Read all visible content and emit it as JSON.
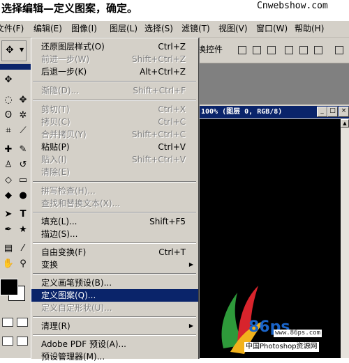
{
  "caption": "选择编辑—定义图案，确定。",
  "site": "Cnwebshow.com",
  "menubar": [
    {
      "name": "menu-file",
      "label": "文件(F)"
    },
    {
      "name": "menu-edit",
      "label": "编辑(E)"
    },
    {
      "name": "menu-image",
      "label": "图像(I)"
    },
    {
      "name": "menu-layer",
      "label": "图层(L)"
    },
    {
      "name": "menu-select",
      "label": "选择(S)"
    },
    {
      "name": "menu-filter",
      "label": "滤镜(T)"
    },
    {
      "name": "menu-view",
      "label": "视图(V)"
    },
    {
      "name": "menu-window",
      "label": "窗口(W)"
    },
    {
      "name": "menu-help",
      "label": "帮助(H)"
    }
  ],
  "optbar": {
    "label": "换控件"
  },
  "document": {
    "title": "100% (图层 0, RGB/8)"
  },
  "watermark": {
    "url": "www.86ps.com",
    "name": "中国Photoshop资源网",
    "logo": "86ps"
  },
  "edit_menu": [
    {
      "label": "还原图层样式(O)",
      "shortcut": "Ctrl+Z",
      "state": "normal"
    },
    {
      "label": "前进一步(W)",
      "shortcut": "Shift+Ctrl+Z",
      "state": "disabled"
    },
    {
      "label": "后退一步(K)",
      "shortcut": "Alt+Ctrl+Z",
      "state": "normal"
    },
    {
      "label": "渐隐(D)...",
      "shortcut": "Shift+Ctrl+F",
      "state": "disabled"
    },
    {
      "label": "剪切(T)",
      "shortcut": "Ctrl+X",
      "state": "disabled"
    },
    {
      "label": "拷贝(C)",
      "shortcut": "Ctrl+C",
      "state": "disabled"
    },
    {
      "label": "合并拷贝(Y)",
      "shortcut": "Shift+Ctrl+C",
      "state": "disabled"
    },
    {
      "label": "粘贴(P)",
      "shortcut": "Ctrl+V",
      "state": "normal"
    },
    {
      "label": "贴入(I)",
      "shortcut": "Shift+Ctrl+V",
      "state": "disabled"
    },
    {
      "label": "清除(E)",
      "shortcut": "",
      "state": "disabled"
    },
    {
      "label": "拼写检查(H)...",
      "shortcut": "",
      "state": "disabled"
    },
    {
      "label": "查找和替换文本(X)...",
      "shortcut": "",
      "state": "disabled"
    },
    {
      "label": "填充(L)...",
      "shortcut": "Shift+F5",
      "state": "normal"
    },
    {
      "label": "描边(S)...",
      "shortcut": "",
      "state": "normal"
    },
    {
      "label": "自由变换(F)",
      "shortcut": "Ctrl+T",
      "state": "normal"
    },
    {
      "label": "变换",
      "shortcut": "",
      "state": "normal",
      "submenu": true
    },
    {
      "label": "定义画笔预设(B)...",
      "shortcut": "",
      "state": "normal"
    },
    {
      "label": "定义图案(Q)...",
      "shortcut": "",
      "state": "highlighted"
    },
    {
      "label": "定义自定形状(U)...",
      "shortcut": "",
      "state": "disabled"
    },
    {
      "label": "清理(R)",
      "shortcut": "",
      "state": "normal",
      "submenu": true
    },
    {
      "label": "Adobe PDF 预设(A)...",
      "shortcut": "",
      "state": "normal"
    },
    {
      "label": "预设管理器(M)...",
      "shortcut": "",
      "state": "normal"
    }
  ],
  "tools": [
    {
      "name": "move-tool-icon",
      "glyph": "✥"
    },
    {
      "name": "marquee-tool-icon",
      "glyph": "◌"
    },
    {
      "name": "lasso-tool-icon",
      "glyph": "ʘ"
    },
    {
      "name": "magic-wand-tool-icon",
      "glyph": "✲"
    },
    {
      "name": "crop-tool-icon",
      "glyph": "⌗"
    },
    {
      "name": "slice-tool-icon",
      "glyph": "⟋"
    },
    {
      "name": "healing-brush-tool-icon",
      "glyph": "✚"
    },
    {
      "name": "brush-tool-icon",
      "glyph": "✎"
    },
    {
      "name": "clone-stamp-tool-icon",
      "glyph": "♙"
    },
    {
      "name": "history-brush-tool-icon",
      "glyph": "↺"
    },
    {
      "name": "eraser-tool-icon",
      "glyph": "◇"
    },
    {
      "name": "gradient-tool-icon",
      "glyph": "▭"
    },
    {
      "name": "blur-tool-icon",
      "glyph": "◆"
    },
    {
      "name": "dodge-tool-icon",
      "glyph": "●"
    },
    {
      "name": "path-select-tool-icon",
      "glyph": "➤"
    },
    {
      "name": "type-tool-icon",
      "glyph": "T"
    },
    {
      "name": "pen-tool-icon",
      "glyph": "✒"
    },
    {
      "name": "shape-tool-icon",
      "glyph": "★"
    },
    {
      "name": "notes-tool-icon",
      "glyph": "▤"
    },
    {
      "name": "eyedropper-tool-icon",
      "glyph": "⁄"
    },
    {
      "name": "hand-tool-icon",
      "glyph": "✋"
    },
    {
      "name": "zoom-tool-icon",
      "glyph": "⚲"
    }
  ]
}
